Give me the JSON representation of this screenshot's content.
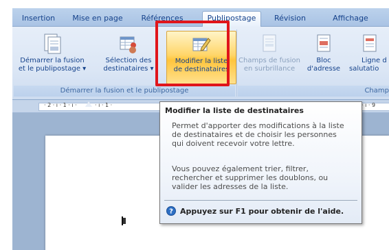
{
  "tabs": [
    {
      "label": "Insertion"
    },
    {
      "label": "Mise en page"
    },
    {
      "label": "Références"
    },
    {
      "label": "Publipostage",
      "active": true
    },
    {
      "label": "Révision"
    },
    {
      "label": "Affichage"
    }
  ],
  "ribbon": {
    "buttons": {
      "demarrer": {
        "line1": "Démarrer la fusion",
        "line2": "et le publipostage ▾"
      },
      "selection": {
        "line1": "Sélection des",
        "line2": "destinataires ▾"
      },
      "modifier": {
        "line1": "Modifier la liste",
        "line2": "de destinataires"
      },
      "champs": {
        "line1": "Champs de fusion",
        "line2": "en surbrillance"
      },
      "bloc": {
        "line1": "Bloc",
        "line2": "d'adresse"
      },
      "ligne": {
        "line1": "Ligne d",
        "line2": "salutatio"
      }
    },
    "groups": {
      "demarrer_group": "Démarrer la fusion et le publipostage",
      "champ_group": "Champ"
    }
  },
  "ruler": {
    "ticks": [
      "· 2 · ı · 1 · ı ·",
      "· ı · 1 ·",
      "· ı · 9"
    ]
  },
  "tooltip": {
    "title": "Modifier la liste de destinataires",
    "p1": [
      "Permet d'apporter des modifications à la liste",
      "de destinataires et de choisir les personnes",
      "qui doivent recevoir votre lettre."
    ],
    "p2": [
      "Vous pouvez également trier, filtrer,",
      "rechercher et supprimer les doublons, ou",
      "valider les adresses de la liste."
    ],
    "help": "Appuyez sur F1 pour obtenir de l'aide."
  },
  "colors": {
    "highlight": "#e0151b",
    "ribbon_text": "#15428b"
  }
}
